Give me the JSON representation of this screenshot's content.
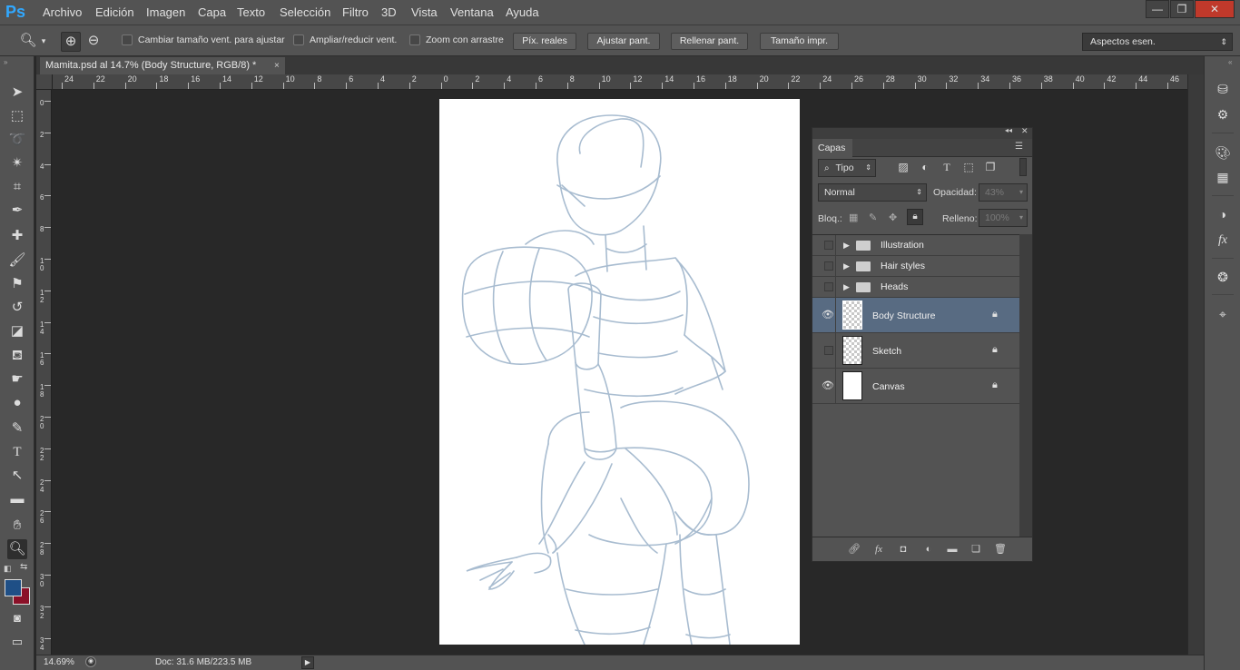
{
  "app": {
    "logo": "Ps"
  },
  "menu": [
    "Archivo",
    "Edición",
    "Imagen",
    "Capa",
    "Texto",
    "Selección",
    "Filtro",
    "3D",
    "Vista",
    "Ventana",
    "Ayuda"
  ],
  "window_controls": {
    "minimize": "—",
    "restore": "❐",
    "close": "✕"
  },
  "options": {
    "resize_windows": "Cambiar tamaño vent. para ajustar",
    "zoom_all_windows": "Ampliar/reducir vent.",
    "scrubby_zoom": "Zoom con arrastre",
    "actual_pixels": "Píx. reales",
    "fit_screen": "Ajustar pant.",
    "fill_screen": "Rellenar pant.",
    "print_size": "Tamaño impr.",
    "workspace": "Aspectos esen."
  },
  "document": {
    "tab_title": "Mamita.psd al 14.7% (Body Structure, RGB/8) *",
    "close": "×"
  },
  "rulers": {
    "horizontal": [
      "24",
      "22",
      "20",
      "18",
      "16",
      "14",
      "12",
      "10",
      "8",
      "6",
      "4",
      "2",
      "0",
      "2",
      "4",
      "6",
      "8",
      "10",
      "12",
      "14",
      "16",
      "18",
      "20",
      "22",
      "24",
      "26",
      "28",
      "30",
      "32",
      "34",
      "36",
      "38",
      "40",
      "42",
      "44",
      "46"
    ],
    "vertical": [
      "0",
      "2",
      "4",
      "6",
      "8",
      "1\n0",
      "1\n2",
      "1\n4",
      "1\n6",
      "1\n8",
      "2\n0",
      "2\n2",
      "2\n4",
      "2\n6",
      "2\n8",
      "3\n0",
      "3\n2",
      "3\n4"
    ]
  },
  "status": {
    "zoom": "14.69%",
    "doc_info": "Doc: 31.6 MB/223.5 MB"
  },
  "layers_panel": {
    "tab": "Capas",
    "filter_kind": "Tipo",
    "blend_mode": "Normal",
    "opacity_label": "Opacidad:",
    "opacity_value": "43%",
    "lock_label": "Bloq.:",
    "fill_label": "Relleno:",
    "fill_value": "100%",
    "layers": [
      {
        "name": "Illustration",
        "type": "group",
        "visible": false,
        "locked": false,
        "selected": false
      },
      {
        "name": "Hair styles",
        "type": "group",
        "visible": false,
        "locked": false,
        "selected": false
      },
      {
        "name": "Heads",
        "type": "group",
        "visible": false,
        "locked": false,
        "selected": false
      },
      {
        "name": "Body Structure",
        "type": "layer",
        "visible": true,
        "locked": true,
        "selected": true
      },
      {
        "name": "Sketch",
        "type": "layer",
        "visible": false,
        "locked": true,
        "selected": false
      },
      {
        "name": "Canvas",
        "type": "layer",
        "visible": true,
        "locked": true,
        "selected": false
      }
    ]
  },
  "colors": {
    "foreground": "#1f4f86",
    "background": "#8a1028",
    "sketch_stroke": "#a8bcd0",
    "selection": "#586b82"
  }
}
